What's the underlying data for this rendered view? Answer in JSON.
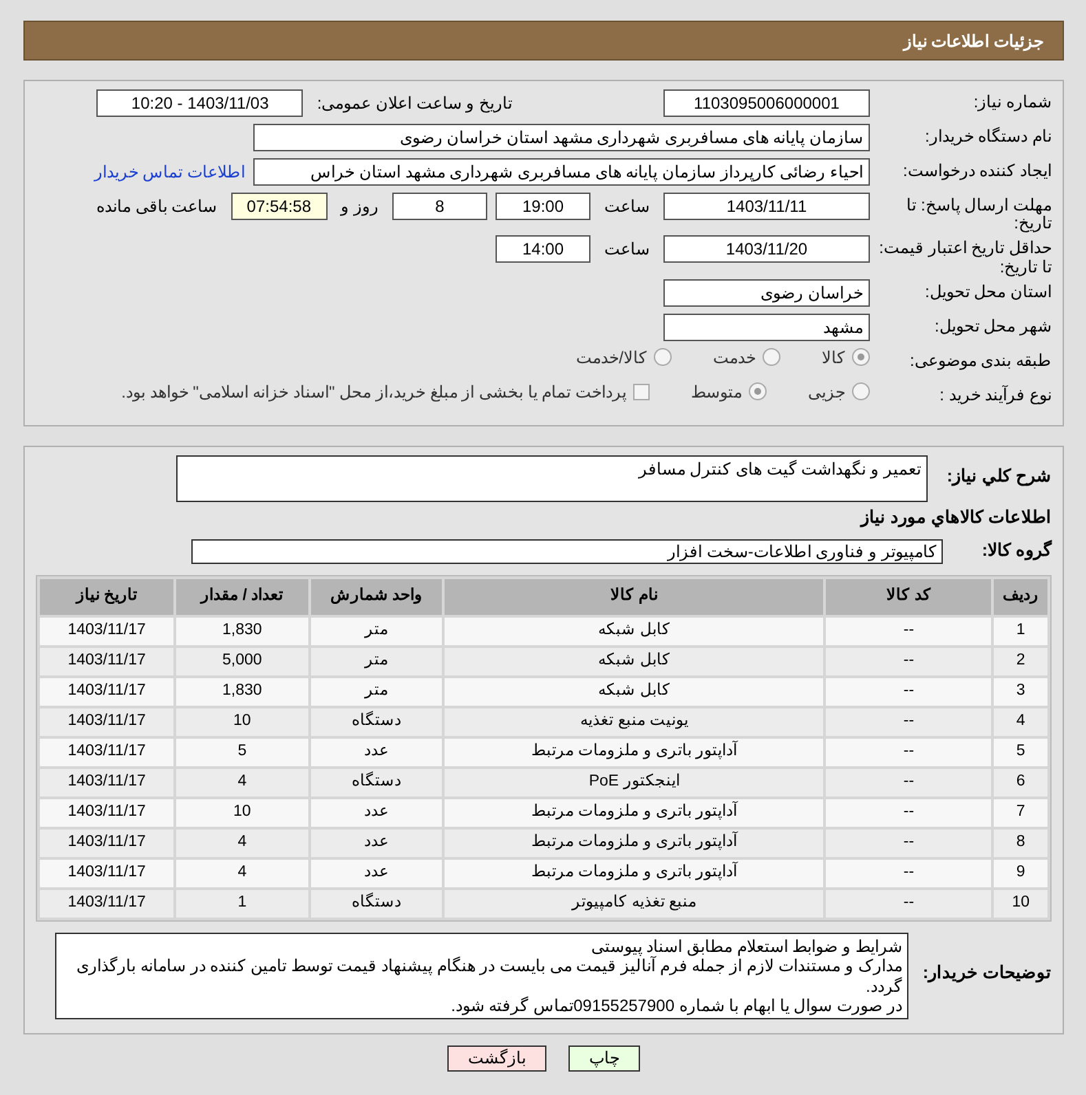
{
  "header": {
    "title": "جزئیات اطلاعات نیاز"
  },
  "form_rows": [
    {
      "label": "شماره نیاز:",
      "items": [
        {
          "kind": "field",
          "value": "1103095006000001"
        },
        {
          "kind": "caption",
          "value": "تاریخ و ساعت اعلان عمومی:"
        },
        {
          "kind": "field",
          "value": "1403/11/03 - 10:20"
        }
      ]
    },
    {
      "label": "نام دستگاه خریدار:",
      "items": [
        {
          "kind": "wide",
          "value": "سازمان پایانه های مسافربری شهرداری مشهد استان خراسان رضوی"
        }
      ]
    },
    {
      "label": "ایجاد کننده درخواست:",
      "items": [
        {
          "kind": "wide",
          "value": "احیاء رضائی کارپرداز سازمان پایانه های مسافربری شهرداری مشهد استان خراس"
        },
        {
          "kind": "link",
          "value": "اطلاعات تماس خریدار"
        }
      ]
    },
    {
      "label": "مهلت ارسال پاسخ: تا تاریخ:",
      "items": [
        {
          "kind": "field",
          "value": "1403/11/11"
        },
        {
          "kind": "caption",
          "value": "ساعت"
        },
        {
          "kind": "small",
          "value": "19:00"
        },
        {
          "kind": "small",
          "value": "8"
        },
        {
          "kind": "caption",
          "value": "روز و"
        },
        {
          "kind": "timer",
          "value": "07:54:58"
        },
        {
          "kind": "caption",
          "value": "ساعت باقی مانده"
        }
      ]
    },
    {
      "label": "حداقل تاریخ اعتبار قیمت: تا تاریخ:",
      "items": [
        {
          "kind": "field",
          "value": "1403/11/20"
        },
        {
          "kind": "caption",
          "value": "ساعت"
        },
        {
          "kind": "small",
          "value": "14:00"
        }
      ]
    },
    {
      "label": "استان محل تحویل:",
      "items": [
        {
          "kind": "field",
          "value": "خراسان رضوی"
        }
      ]
    },
    {
      "label": "شهر محل تحویل:",
      "items": [
        {
          "kind": "field",
          "value": "مشهد"
        }
      ]
    },
    {
      "label": "طبقه بندی موضوعی:",
      "items": [
        {
          "kind": "radio",
          "value": "کالا",
          "selected": true
        },
        {
          "kind": "radio",
          "value": "خدمت",
          "selected": false
        },
        {
          "kind": "radio",
          "value": "کالا/خدمت",
          "selected": false
        }
      ]
    },
    {
      "label": "نوع فرآیند خرید :",
      "items": [
        {
          "kind": "radio",
          "value": "جزیی",
          "selected": false
        },
        {
          "kind": "radio",
          "value": "متوسط",
          "selected": true
        },
        {
          "kind": "checkbox",
          "value": "پرداخت تمام یا بخشی از مبلغ خرید،از محل \"اسناد خزانه اسلامی\" خواهد بود.",
          "checked": false
        }
      ]
    }
  ],
  "description": {
    "label": "شرح کلي نياز:",
    "value": "تعمیر و نگهداشت گیت های کنترل مسافر"
  },
  "goods_heading": "اطلاعات کالاهاي مورد نياز",
  "goods_group": {
    "label": "گروه کالا:",
    "value": "کامپیوتر و فناوری اطلاعات-سخت افزار"
  },
  "table": {
    "columns": [
      "ردیف",
      "کد کالا",
      "نام کالا",
      "واحد شمارش",
      "تعداد / مقدار",
      "تاریخ نیاز"
    ],
    "rows": [
      [
        "1",
        "--",
        "کابل شبکه",
        "متر",
        "1,830",
        "1403/11/17"
      ],
      [
        "2",
        "--",
        "کابل شبکه",
        "متر",
        "5,000",
        "1403/11/17"
      ],
      [
        "3",
        "--",
        "کابل شبکه",
        "متر",
        "1,830",
        "1403/11/17"
      ],
      [
        "4",
        "--",
        "یونیت منبع تغذیه",
        "دستگاه",
        "10",
        "1403/11/17"
      ],
      [
        "5",
        "--",
        "آداپتور باتری و ملزومات مرتبط",
        "عدد",
        "5",
        "1403/11/17"
      ],
      [
        "6",
        "--",
        "اینجکتور PoE",
        "دستگاه",
        "4",
        "1403/11/17"
      ],
      [
        "7",
        "--",
        "آداپتور باتری و ملزومات مرتبط",
        "عدد",
        "10",
        "1403/11/17"
      ],
      [
        "8",
        "--",
        "آداپتور باتری و ملزومات مرتبط",
        "عدد",
        "4",
        "1403/11/17"
      ],
      [
        "9",
        "--",
        "آداپتور باتری و ملزومات مرتبط",
        "عدد",
        "4",
        "1403/11/17"
      ],
      [
        "10",
        "--",
        "منبع تغذیه کامپیوتر",
        "دستگاه",
        "1",
        "1403/11/17"
      ]
    ]
  },
  "buyer_notes": {
    "label": "توضیحات خریدار:",
    "lines": [
      "شرایط و ضوابط استعلام مطابق اسناد پیوستی",
      "مدارک و مستندات لازم از جمله فرم آنالیز قیمت می بایست در هنگام پیشنهاد قیمت توسط تامین کننده در سامانه بارگذاری گردد.",
      "در صورت سوال یا ابهام با شماره 09155257900تماس گرفته شود."
    ]
  },
  "buttons": [
    {
      "kind": "print",
      "label": "چاپ"
    },
    {
      "kind": "back",
      "label": "بازگشت"
    }
  ]
}
